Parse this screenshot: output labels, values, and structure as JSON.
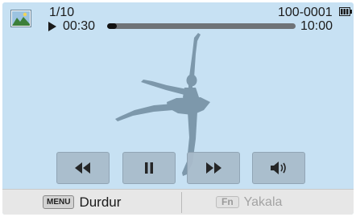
{
  "header": {
    "image_counter": "1/10",
    "elapsed_time": "00:30",
    "file_number": "100-0001",
    "total_time": "10:00",
    "playback_progress": 0.05
  },
  "controls": {
    "rewind_icon": "rewind-icon",
    "pause_icon": "pause-icon",
    "fast_forward_icon": "fast-forward-icon",
    "volume_icon": "volume-icon"
  },
  "bottom_bar": {
    "menu_key": "MENU",
    "menu_label": "Durdur",
    "fn_key": "Fn",
    "fn_label": "Yakala"
  },
  "colors": {
    "screen_background": "#c7e1f3",
    "button_background": "#a9bccb",
    "bottom_bar_background": "#e7e7e7",
    "silhouette": "#7d98ab"
  }
}
